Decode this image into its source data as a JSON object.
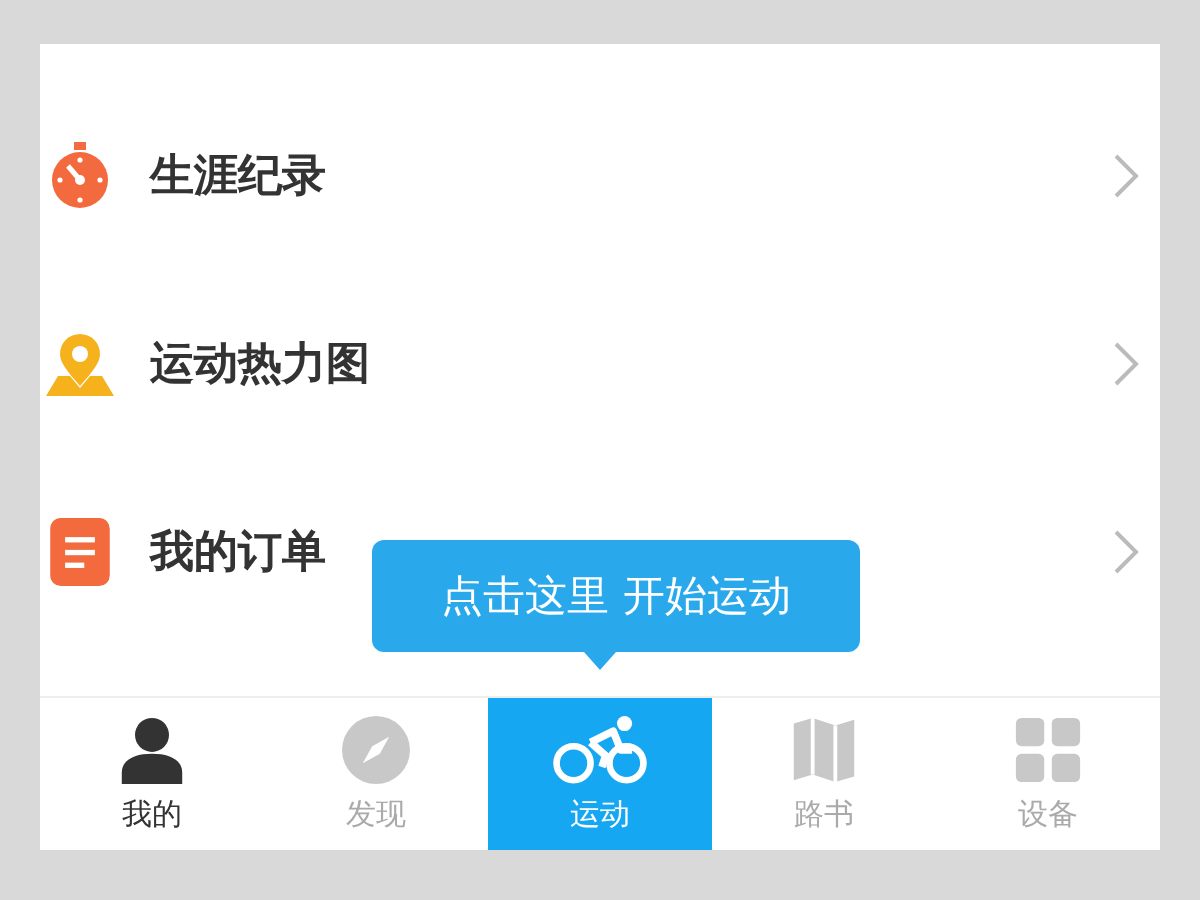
{
  "menu_items": [
    {
      "kind": "stopwatch",
      "label": "生涯纪录"
    },
    {
      "kind": "map-pin",
      "label": "运动热力图"
    },
    {
      "kind": "document",
      "label": "我的订单"
    }
  ],
  "tooltip": {
    "text": "点击这里 开始运动"
  },
  "tabs": [
    {
      "kind": "person",
      "label": "我的",
      "selected": false,
      "current": true
    },
    {
      "kind": "compass",
      "label": "发现",
      "selected": false,
      "current": false
    },
    {
      "kind": "bike",
      "label": "运动",
      "selected": true,
      "current": false
    },
    {
      "kind": "map",
      "label": "路书",
      "selected": false,
      "current": false
    },
    {
      "kind": "grid",
      "label": "设备",
      "selected": false,
      "current": false
    }
  ]
}
